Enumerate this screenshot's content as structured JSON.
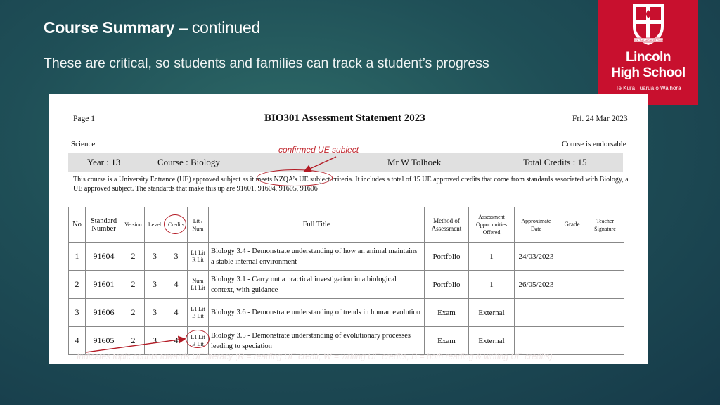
{
  "slide": {
    "title_bold": "Course Summary",
    "title_rest": " – continued",
    "subtitle": "These are critical, so students and families can track a student’s progress"
  },
  "logo": {
    "crest_text": "SEEK THE HIGHEST GOOD",
    "name_line1": "Lincoln",
    "name_line2": "High School",
    "tagline": "Te Kura Tuarua o Waihora",
    "color": "#c8102e"
  },
  "statement": {
    "page_label": "Page 1",
    "title": "BIO301 Assessment Statement 2023",
    "date": "Fri. 24 Mar 2023",
    "department": "Science",
    "endorsable": "Course is endorsable",
    "year": "Year : 13",
    "course": "Course : Biology",
    "teacher": "Mr W Tolhoek",
    "total_credits": "Total Credits : 15",
    "description": "This course is a University Entrance (UE) approved subject as it meets NZQA’s UE subject criteria. It includes a total of 15 UE approved credits that come from standards associated with Biology, a UE approved subject. The standards that make this up are 91601, 91604, 91605, 91606",
    "headers": {
      "no": "No",
      "standard": "Standard Number",
      "version": "Version",
      "level": "Level",
      "credits": "Credits",
      "lit_num": "Lit / Num",
      "full_title": "Full Title",
      "method": "Method of Assessment",
      "opportunities": "Assessment Opportunities Offered",
      "approx_date": "Approximate Date",
      "grade": "Grade",
      "teacher_sig": "Teacher Signature"
    },
    "rows": [
      {
        "no": "1",
        "standard": "91604",
        "version": "2",
        "level": "3",
        "credits": "3",
        "lit1": "L1 Lit",
        "lit2": "R Lit",
        "title": "Biology 3.4 - Demonstrate understanding of how an animal maintains a stable internal environment",
        "method": "Portfolio",
        "opps": "1",
        "date": "24/03/2023",
        "grade": "",
        "signature": ""
      },
      {
        "no": "2",
        "standard": "91601",
        "version": "2",
        "level": "3",
        "credits": "4",
        "lit1": "Num",
        "lit2": "L1 Lit",
        "title": "Biology 3.1 - Carry out a practical investigation in a biological context, with guidance",
        "method": "Portfolio",
        "opps": "1",
        "date": "26/05/2023",
        "grade": "",
        "signature": ""
      },
      {
        "no": "3",
        "standard": "91606",
        "version": "2",
        "level": "3",
        "credits": "4",
        "lit1": "L1 Lit",
        "lit2": "B Lit",
        "title": "Biology 3.6 - Demonstrate understanding of trends in human evolution",
        "method": "Exam",
        "opps": "External",
        "date": "",
        "grade": "",
        "signature": ""
      },
      {
        "no": "4",
        "standard": "91605",
        "version": "2",
        "level": "3",
        "credits": "4",
        "lit1": "L1 Lit",
        "lit2": "B Lit",
        "title": "Biology 3.5 - Demonstrate understanding of evolutionary processes leading to speciation",
        "method": "Exam",
        "opps": "External",
        "date": "",
        "grade": "",
        "signature": ""
      }
    ]
  },
  "annotations": {
    "ue_subject": "confirmed UE subject",
    "literacy": "Indicates topic counts towards UE literacy (R = reading UE credit, W = writing UE credits, B = both reading & writing UE credits).",
    "color": "#b31a24"
  }
}
